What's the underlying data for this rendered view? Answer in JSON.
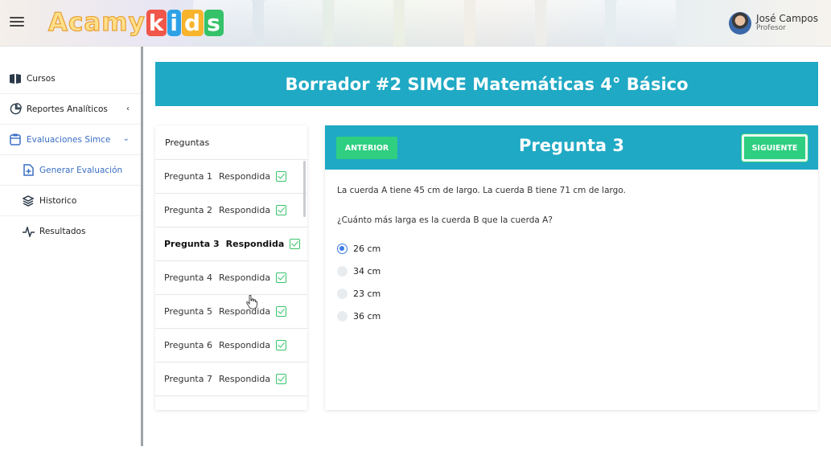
{
  "app": {
    "logo_text_1": "Acamy",
    "logo_text_2": "kids",
    "user_name": "José Campos",
    "user_role": "Profesor"
  },
  "sidebar": {
    "items": [
      {
        "label": "Cursos",
        "icon": "book-icon"
      },
      {
        "label": "Reportes Analíticos",
        "icon": "pie-chart-icon"
      },
      {
        "label": "Evaluaciones Simce",
        "icon": "clipboard-icon"
      },
      {
        "label": "Generar Evaluación",
        "icon": "file-plus-icon"
      },
      {
        "label": "Historico",
        "icon": "layers-icon"
      },
      {
        "label": "Resultados",
        "icon": "activity-icon"
      }
    ]
  },
  "page": {
    "title": "Borrador #2 SIMCE Matemáticas 4° Básico"
  },
  "questions_panel": {
    "header": "Preguntas",
    "items": [
      {
        "label": "Pregunta 1",
        "status": "Respondida"
      },
      {
        "label": "Pregunta 2",
        "status": "Respondida"
      },
      {
        "label": "Pregunta 3",
        "status": "Respondida"
      },
      {
        "label": "Pregunta 4",
        "status": "Respondida"
      },
      {
        "label": "Pregunta 5",
        "status": "Respondida"
      },
      {
        "label": "Pregunta 6",
        "status": "Respondida"
      },
      {
        "label": "Pregunta 7",
        "status": "Respondida"
      }
    ]
  },
  "question": {
    "prev_label": "ANTERIOR",
    "next_label": "SIGUIENTE",
    "title": "Pregunta 3",
    "text_1": "La cuerda A tiene 45 cm de largo. La cuerda B tiene 71 cm de largo.",
    "text_2": "¿Cuánto más larga es la cuerda B que la cuerda A?",
    "options": [
      "26 cm",
      "34 cm",
      "23 cm",
      "36 cm"
    ],
    "selected_option": "26 cm"
  },
  "colors": {
    "accent": "#1fa9c4",
    "button_green": "#2ecf80",
    "check_green": "#38c46a",
    "link_blue": "#3a6fc4"
  }
}
